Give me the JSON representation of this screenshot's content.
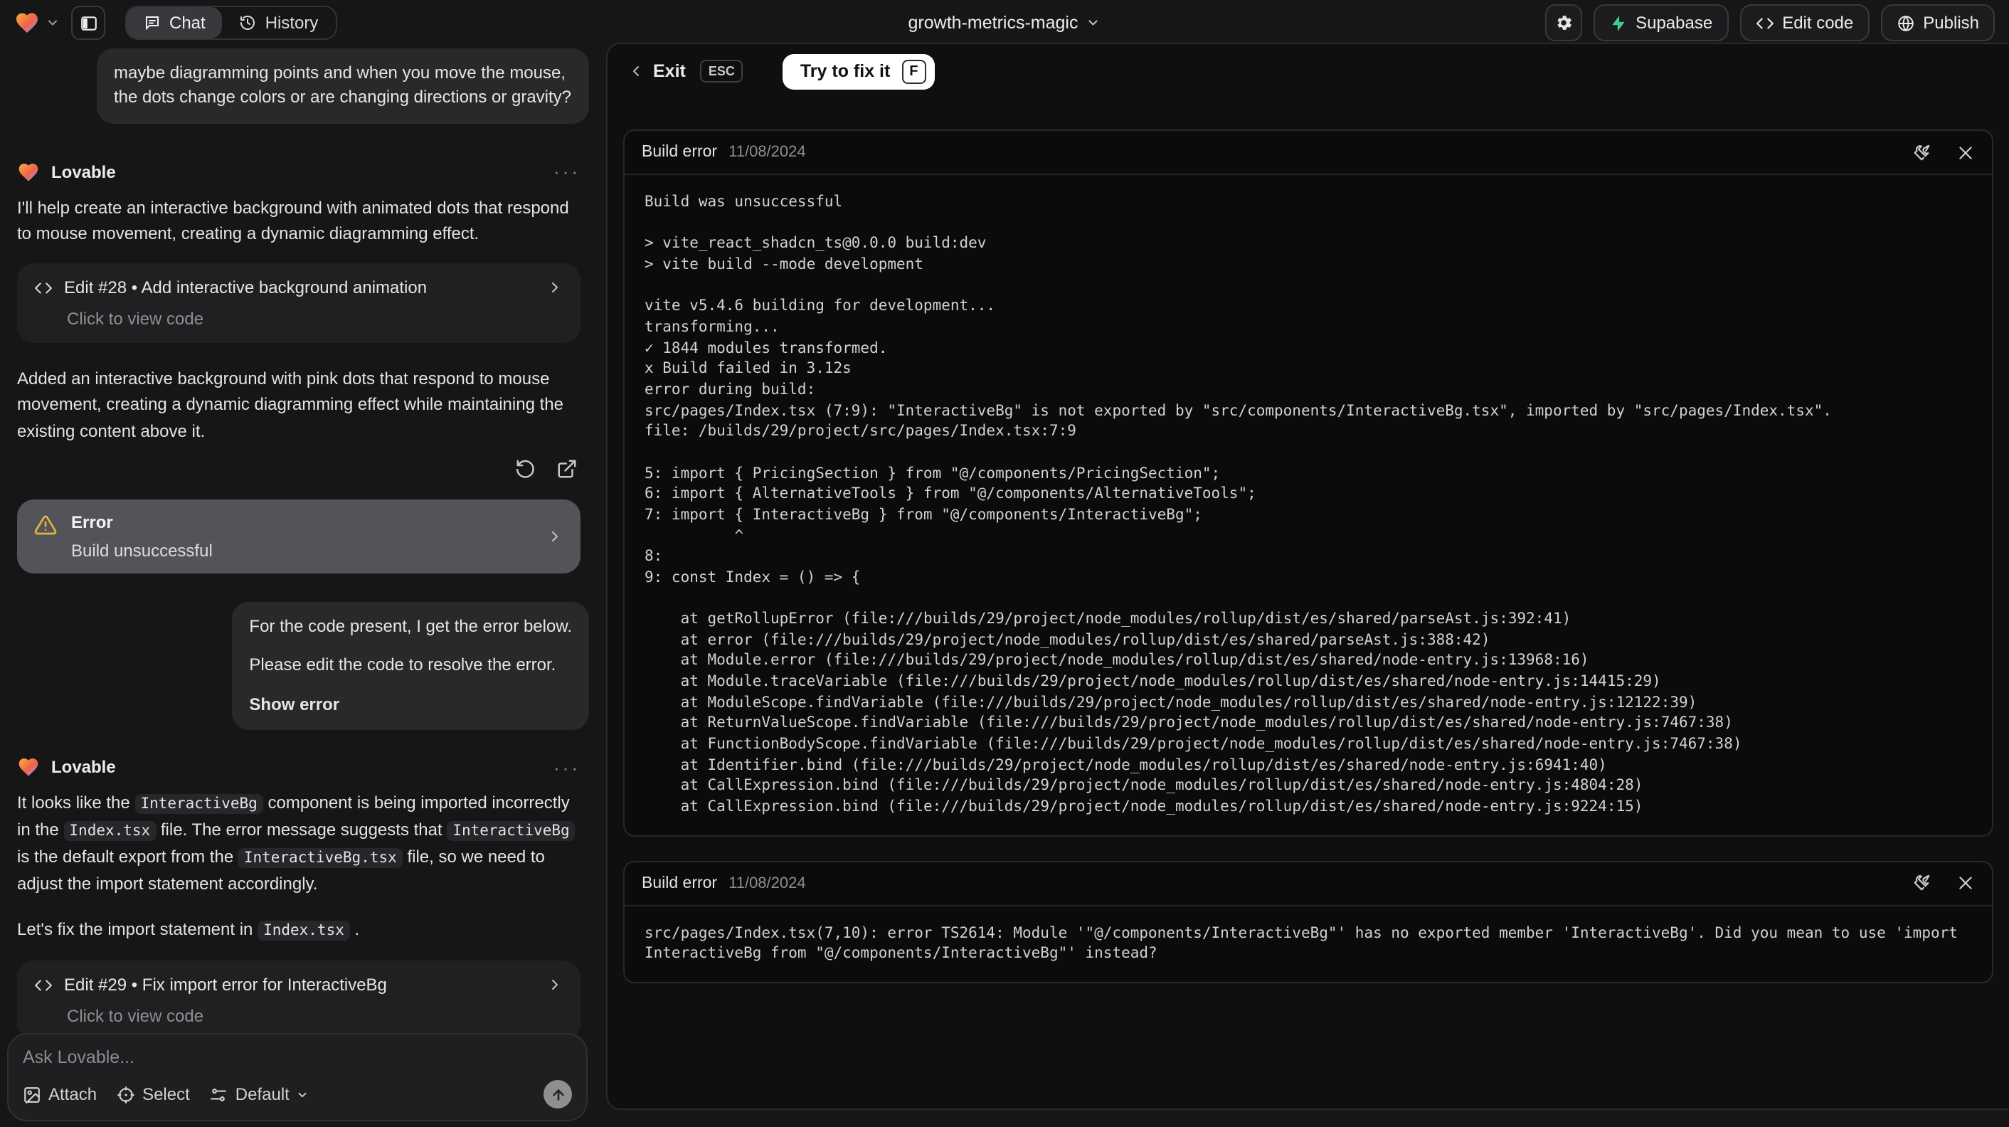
{
  "topbar": {
    "tabs": [
      {
        "label": "Chat"
      },
      {
        "label": "History"
      }
    ],
    "project_name": "growth-metrics-magic",
    "actions": {
      "supabase": "Supabase",
      "edit_code": "Edit code",
      "publish": "Publish"
    }
  },
  "chat": {
    "assistant_name": "Lovable",
    "menu_dots": "···",
    "user_msg_1": "maybe diagramming points and when you move the mouse, the dots change colors or are changing directions or gravity?",
    "lovable_msg_1": "I'll help create an interactive background with animated dots that respond to mouse movement, creating a dynamic diagramming effect.",
    "edit_28": {
      "title": "Edit #28 • Add interactive background animation",
      "subtitle": "Click to view code"
    },
    "lovable_msg_1b": "Added an interactive background with pink dots that respond to mouse movement, creating a dynamic diagramming effect while maintaining the existing content above it.",
    "error_card": {
      "title": "Error",
      "subtitle": "Build unsuccessful"
    },
    "user_msg_2": {
      "line1": "For the code present, I get the error below.",
      "line2": "Please edit the code to resolve the error.",
      "action": "Show error"
    },
    "lovable_msg_2_segments": [
      {
        "t": "It looks like the "
      },
      {
        "c": "InteractiveBg"
      },
      {
        "t": " component is being imported incorrectly in the "
      },
      {
        "c": "Index.tsx"
      },
      {
        "t": " file. The error message suggests that "
      },
      {
        "c": "InteractiveBg"
      },
      {
        "t": " is the default export from the "
      },
      {
        "c": "InteractiveBg.tsx"
      },
      {
        "t": " file, so we need to adjust the import statement accordingly."
      }
    ],
    "lovable_msg_2b_segments": [
      {
        "t": "Let's fix the import statement in "
      },
      {
        "c": "Index.tsx"
      },
      {
        "t": " ."
      }
    ],
    "edit_29": {
      "title": "Edit #29 • Fix import error for InteractiveBg",
      "subtitle": "Click to view code"
    },
    "input": {
      "placeholder": "Ask Lovable...",
      "attach": "Attach",
      "select": "Select",
      "mode": "Default"
    }
  },
  "fix_panel": {
    "exit_label": "Exit",
    "esc_key": "ESC",
    "fix_button": "Try to fix it",
    "fix_key": "F",
    "cards": [
      {
        "title": "Build error",
        "date": "11/08/2024",
        "lines": [
          "Build was unsuccessful",
          "",
          "> vite_react_shadcn_ts@0.0.0 build:dev",
          "> vite build --mode development",
          "",
          "vite v5.4.6 building for development...",
          "transforming...",
          "✓ 1844 modules transformed.",
          "x Build failed in 3.12s",
          "error during build:",
          "src/pages/Index.tsx (7:9): \"InteractiveBg\" is not exported by \"src/components/InteractiveBg.tsx\", imported by \"src/pages/Index.tsx\".",
          "file: /builds/29/project/src/pages/Index.tsx:7:9",
          "",
          "5: import { PricingSection } from \"@/components/PricingSection\";",
          "6: import { AlternativeTools } from \"@/components/AlternativeTools\";",
          "7: import { InteractiveBg } from \"@/components/InteractiveBg\";",
          "          ^",
          "8:",
          "9: const Index = () => {",
          "",
          "    at getRollupError (file:///builds/29/project/node_modules/rollup/dist/es/shared/parseAst.js:392:41)",
          "    at error (file:///builds/29/project/node_modules/rollup/dist/es/shared/parseAst.js:388:42)",
          "    at Module.error (file:///builds/29/project/node_modules/rollup/dist/es/shared/node-entry.js:13968:16)",
          "    at Module.traceVariable (file:///builds/29/project/node_modules/rollup/dist/es/shared/node-entry.js:14415:29)",
          "    at ModuleScope.findVariable (file:///builds/29/project/node_modules/rollup/dist/es/shared/node-entry.js:12122:39)",
          "    at ReturnValueScope.findVariable (file:///builds/29/project/node_modules/rollup/dist/es/shared/node-entry.js:7467:38)",
          "    at FunctionBodyScope.findVariable (file:///builds/29/project/node_modules/rollup/dist/es/shared/node-entry.js:7467:38)",
          "    at Identifier.bind (file:///builds/29/project/node_modules/rollup/dist/es/shared/node-entry.js:6941:40)",
          "    at CallExpression.bind (file:///builds/29/project/node_modules/rollup/dist/es/shared/node-entry.js:4804:28)",
          "    at CallExpression.bind (file:///builds/29/project/node_modules/rollup/dist/es/shared/node-entry.js:9224:15)"
        ]
      },
      {
        "title": "Build error",
        "date": "11/08/2024",
        "lines": [
          "src/pages/Index.tsx(7,10): error TS2614: Module '\"@/components/InteractiveBg\"' has no exported member 'InteractiveBg'. Did you mean to use 'import InteractiveBg from \"@/components/InteractiveBg\"' instead?"
        ]
      }
    ]
  },
  "colors": {
    "accent_supabase": "#3ecf8e",
    "warning": "#e2b53e",
    "page_bg": "#161617",
    "card_bg": "#0b0b0c"
  }
}
